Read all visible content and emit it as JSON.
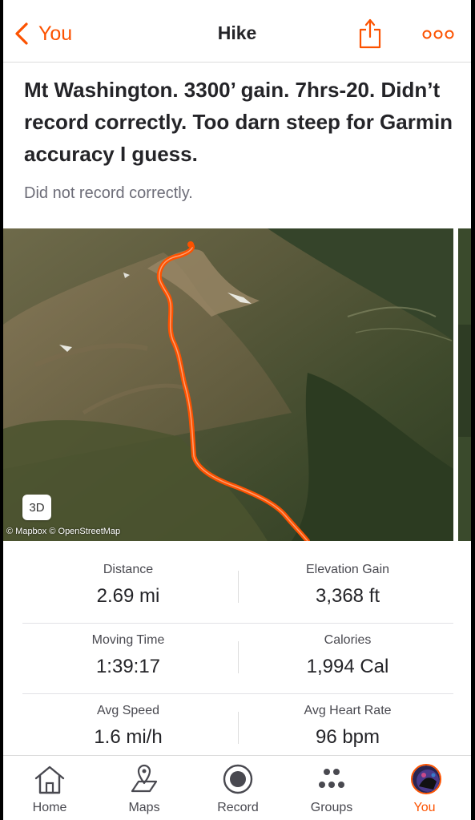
{
  "header": {
    "back_label": "You",
    "title": "Hike"
  },
  "activity": {
    "title": "Mt Washington. 3300’ gain. 7hrs-20. Didn’t record correctly. Too darn steep for Garmin accuracy I guess.",
    "description": "Did not record correctly."
  },
  "map": {
    "toggle_label": "3D",
    "attribution": "© Mapbox © OpenStreetMap",
    "route_color": "#fc5200"
  },
  "stats": [
    {
      "left": {
        "label": "Distance",
        "value": "2.69 mi"
      },
      "right": {
        "label": "Elevation Gain",
        "value": "3,368 ft"
      }
    },
    {
      "left": {
        "label": "Moving Time",
        "value": "1:39:17"
      },
      "right": {
        "label": "Calories",
        "value": "1,994 Cal"
      }
    },
    {
      "left": {
        "label": "Avg Speed",
        "value": "1.6 mi/h"
      },
      "right": {
        "label": "Avg Heart Rate",
        "value": "96 bpm"
      }
    }
  ],
  "tabs": [
    {
      "label": "Home",
      "icon": "home-icon"
    },
    {
      "label": "Maps",
      "icon": "maps-icon"
    },
    {
      "label": "Record",
      "icon": "record-icon"
    },
    {
      "label": "Groups",
      "icon": "groups-icon"
    },
    {
      "label": "You",
      "icon": "avatar",
      "active": true
    }
  ],
  "colors": {
    "accent": "#fc5200",
    "text": "#242428",
    "muted": "#6d6d78"
  }
}
